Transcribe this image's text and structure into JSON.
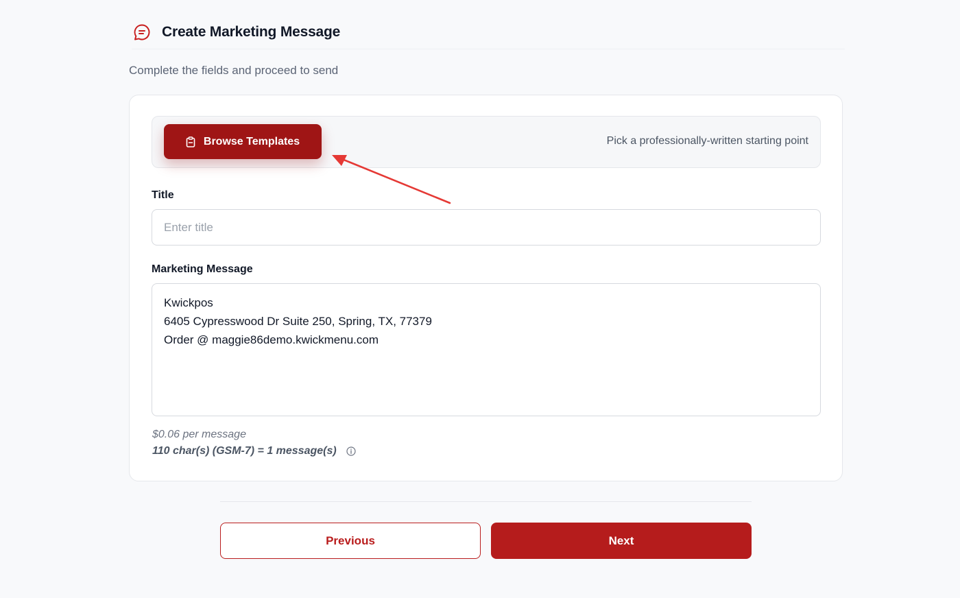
{
  "header": {
    "title": "Create Marketing Message",
    "icon": "message-icon",
    "icon_color": "#c81e1e"
  },
  "subtitle": "Complete the fields and proceed to send",
  "templates": {
    "button_label": "Browse Templates",
    "button_icon": "clipboard-icon",
    "hint": "Pick a professionally-written starting point"
  },
  "title_field": {
    "label": "Title",
    "placeholder": "Enter title",
    "value": ""
  },
  "message_field": {
    "label": "Marketing Message",
    "lines": [
      "Kwickpos",
      "6405 Cypresswood Dr Suite 250, Spring, TX, 77379",
      "Order @ maggie86demo.kwickmenu.com"
    ]
  },
  "pricing": {
    "per_message": "$0.06 per message",
    "char_count": "110 char(s) (GSM-7) = 1 message(s)",
    "info_icon": "info-icon"
  },
  "footer": {
    "previous_label": "Previous",
    "next_label": "Next"
  },
  "colors": {
    "brand": "#b51c1c",
    "brand_dark": "#9f1515",
    "annotation_arrow": "#e53935"
  }
}
